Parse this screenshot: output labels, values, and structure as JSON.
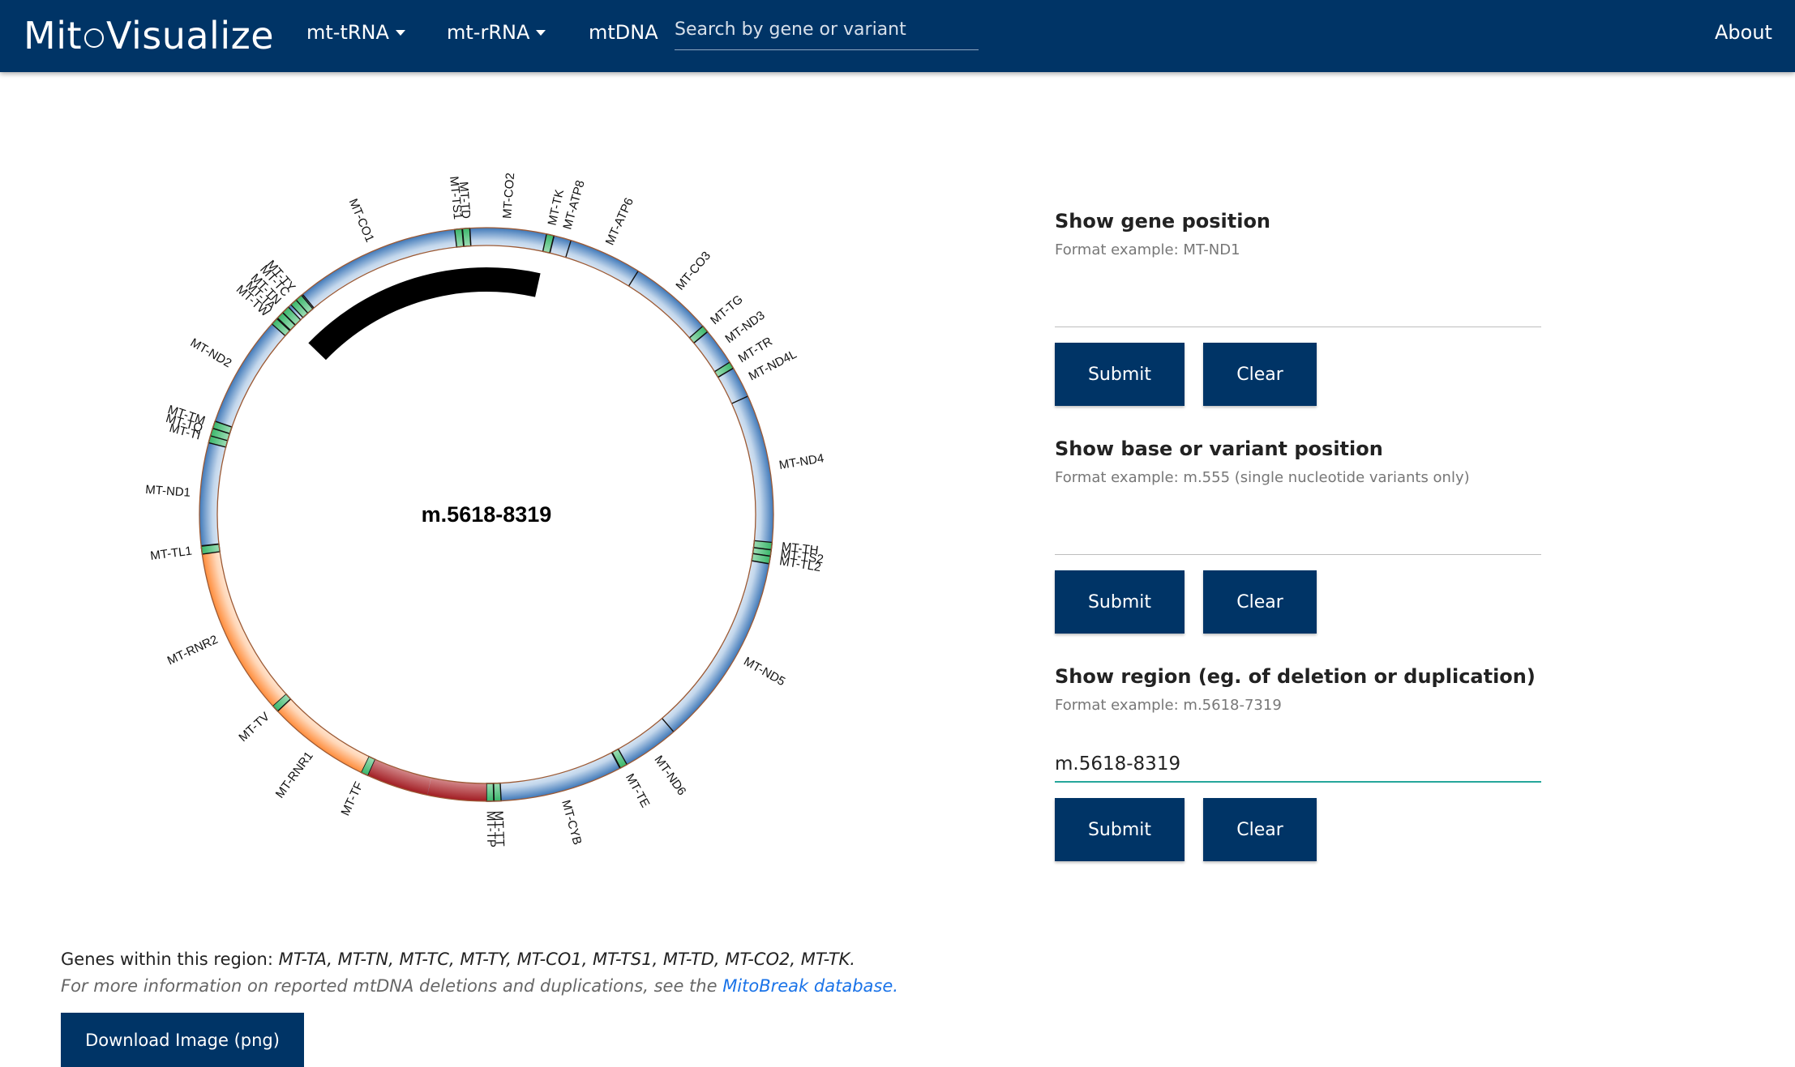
{
  "navbar": {
    "brand_left": "Mit",
    "brand_right": "Visualize",
    "menu": [
      {
        "label": "mt-tRNA",
        "dropdown": true
      },
      {
        "label": "mt-rRNA",
        "dropdown": true
      },
      {
        "label": "mtDNA",
        "dropdown": false
      }
    ],
    "search_placeholder": "Search by gene or variant",
    "about_label": "About"
  },
  "colors": {
    "navbar": "#003466",
    "button": "#003466",
    "coding_gene": "#3f78b8",
    "trna": "#3ab76b",
    "rrna": "#ff8c3a",
    "control_region": "#a11c22",
    "highlight_region": "#000000",
    "input_focus": "#26a69a",
    "link": "#1a73e8"
  },
  "chart_data": {
    "type": "circular-genome-map",
    "total_length": 16569,
    "center_label": "m.5618-8319",
    "highlight": {
      "start": 5618,
      "end": 8319
    },
    "regions": [
      {
        "name": "MT-TF",
        "type": "trna",
        "start": 577,
        "end": 647
      },
      {
        "name": "MT-RNR1",
        "type": "rrna",
        "start": 648,
        "end": 1601
      },
      {
        "name": "MT-TV",
        "type": "trna",
        "start": 1602,
        "end": 1670
      },
      {
        "name": "MT-RNR2",
        "type": "rrna",
        "start": 1671,
        "end": 3229
      },
      {
        "name": "MT-TL1",
        "type": "trna",
        "start": 3230,
        "end": 3304
      },
      {
        "name": "MT-ND1",
        "type": "coding",
        "start": 3307,
        "end": 4262
      },
      {
        "name": "MT-TI",
        "type": "trna",
        "start": 4263,
        "end": 4331
      },
      {
        "name": "MT-TQ",
        "type": "trna",
        "start": 4329,
        "end": 4400
      },
      {
        "name": "MT-TM",
        "type": "trna",
        "start": 4402,
        "end": 4469
      },
      {
        "name": "MT-ND2",
        "type": "coding",
        "start": 4470,
        "end": 5511
      },
      {
        "name": "MT-TW",
        "type": "trna",
        "start": 5512,
        "end": 5579
      },
      {
        "name": "MT-TA",
        "type": "trna",
        "start": 5587,
        "end": 5655
      },
      {
        "name": "MT-TN",
        "type": "trna",
        "start": 5657,
        "end": 5729
      },
      {
        "name": "MT-TC",
        "type": "trna",
        "start": 5761,
        "end": 5826
      },
      {
        "name": "MT-TY",
        "type": "trna",
        "start": 5826,
        "end": 5891
      },
      {
        "name": "MT-CO1",
        "type": "coding",
        "start": 5904,
        "end": 7445
      },
      {
        "name": "MT-TS1",
        "type": "trna",
        "start": 7446,
        "end": 7514
      },
      {
        "name": "MT-TD",
        "type": "trna",
        "start": 7518,
        "end": 7585
      },
      {
        "name": "MT-CO2",
        "type": "coding",
        "start": 7586,
        "end": 8269
      },
      {
        "name": "MT-TK",
        "type": "trna",
        "start": 8295,
        "end": 8364
      },
      {
        "name": "MT-ATP8",
        "type": "coding",
        "start": 8366,
        "end": 8572
      },
      {
        "name": "MT-ATP6",
        "type": "coding",
        "start": 8527,
        "end": 9207
      },
      {
        "name": "MT-CO3",
        "type": "coding",
        "start": 9207,
        "end": 9990
      },
      {
        "name": "MT-TG",
        "type": "trna",
        "start": 9991,
        "end": 10058
      },
      {
        "name": "MT-ND3",
        "type": "coding",
        "start": 10059,
        "end": 10404
      },
      {
        "name": "MT-TR",
        "type": "trna",
        "start": 10405,
        "end": 10469
      },
      {
        "name": "MT-ND4L",
        "type": "coding",
        "start": 10470,
        "end": 10766
      },
      {
        "name": "MT-ND4",
        "type": "coding",
        "start": 10760,
        "end": 12137
      },
      {
        "name": "MT-TH",
        "type": "trna",
        "start": 12138,
        "end": 12206
      },
      {
        "name": "MT-TS2",
        "type": "trna",
        "start": 12207,
        "end": 12265
      },
      {
        "name": "MT-TL2",
        "type": "trna",
        "start": 12266,
        "end": 12336
      },
      {
        "name": "MT-ND5",
        "type": "coding",
        "start": 12337,
        "end": 14148
      },
      {
        "name": "MT-ND6",
        "type": "coding",
        "start": 14149,
        "end": 14673
      },
      {
        "name": "MT-TE",
        "type": "trna",
        "start": 14674,
        "end": 14742
      },
      {
        "name": "MT-CYB",
        "type": "coding",
        "start": 14747,
        "end": 15887
      },
      {
        "name": "MT-TT",
        "type": "trna",
        "start": 15888,
        "end": 15953
      },
      {
        "name": "MT-TP",
        "type": "trna",
        "start": 15956,
        "end": 16023
      },
      {
        "name": "",
        "type": "control",
        "start": 16024,
        "end": 16569
      },
      {
        "name": "",
        "type": "control",
        "start": 1,
        "end": 576
      }
    ]
  },
  "form": {
    "gene": {
      "title": "Show gene position",
      "hint": "Format example: MT-ND1",
      "value": "",
      "submit": "Submit",
      "clear": "Clear"
    },
    "variant": {
      "title": "Show base or variant position",
      "hint": "Format example: m.555 (single nucleotide variants only)",
      "value": "",
      "submit": "Submit",
      "clear": "Clear"
    },
    "region": {
      "title": "Show region (eg. of deletion or duplication)",
      "hint": "Format example: m.5618-7319",
      "value": "m.5618-8319",
      "submit": "Submit",
      "clear": "Clear"
    }
  },
  "info": {
    "genes_prefix": "Genes within this region: ",
    "genes_list": "MT-TA, MT-TN, MT-TC, MT-TY, MT-CO1, MT-TS1, MT-TD, MT-CO2, MT-TK.",
    "more_info_prefix": "For more information on reported mtDNA deletions and duplications, see the ",
    "link_text": "MitoBreak database.",
    "download_label": "Download Image (png)"
  }
}
